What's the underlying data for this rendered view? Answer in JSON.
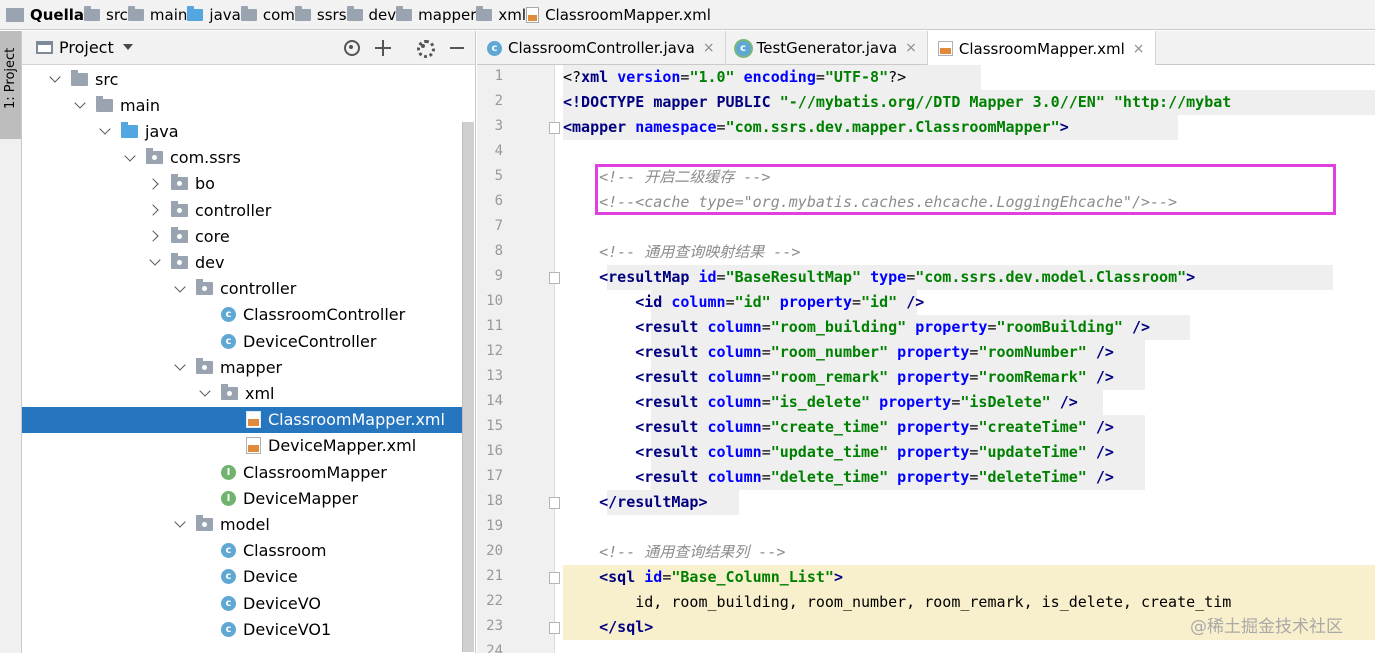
{
  "breadcrumb": [
    {
      "label": "Quella",
      "icon": "module-icon",
      "bold": true
    },
    {
      "label": "src",
      "icon": "folder-icon"
    },
    {
      "label": "main",
      "icon": "folder-icon"
    },
    {
      "label": "java",
      "icon": "folder-icon-blue"
    },
    {
      "label": "com",
      "icon": "folder-icon"
    },
    {
      "label": "ssrs",
      "icon": "folder-icon"
    },
    {
      "label": "dev",
      "icon": "folder-icon"
    },
    {
      "label": "mapper",
      "icon": "folder-icon"
    },
    {
      "label": "xml",
      "icon": "folder-icon"
    },
    {
      "label": "ClassroomMapper.xml",
      "icon": "xml-file-icon"
    }
  ],
  "tool_strip": {
    "project_label": "1: Project"
  },
  "project_panel": {
    "title": "Project"
  },
  "tree": [
    {
      "label": "src",
      "kind": "folder",
      "arrow": "down"
    },
    {
      "label": "main",
      "kind": "folder",
      "arrow": "down"
    },
    {
      "label": "java",
      "kind": "folder-blue",
      "arrow": "down"
    },
    {
      "label": "com.ssrs",
      "kind": "package",
      "arrow": "down"
    },
    {
      "label": "bo",
      "kind": "package",
      "arrow": "right"
    },
    {
      "label": "controller",
      "kind": "package",
      "arrow": "right"
    },
    {
      "label": "core",
      "kind": "package",
      "arrow": "right"
    },
    {
      "label": "dev",
      "kind": "package",
      "arrow": "down"
    },
    {
      "label": "controller",
      "kind": "package",
      "arrow": "down"
    },
    {
      "label": "ClassroomController",
      "kind": "class",
      "arrow": "none"
    },
    {
      "label": "DeviceController",
      "kind": "class",
      "arrow": "none"
    },
    {
      "label": "mapper",
      "kind": "package",
      "arrow": "down"
    },
    {
      "label": "xml",
      "kind": "package",
      "arrow": "down"
    },
    {
      "label": "ClassroomMapper.xml",
      "kind": "xml",
      "arrow": "none",
      "selected": true
    },
    {
      "label": "DeviceMapper.xml",
      "kind": "xml",
      "arrow": "none"
    },
    {
      "label": "ClassroomMapper",
      "kind": "interface",
      "arrow": "none"
    },
    {
      "label": "DeviceMapper",
      "kind": "interface",
      "arrow": "none"
    },
    {
      "label": "model",
      "kind": "package",
      "arrow": "down"
    },
    {
      "label": "Classroom",
      "kind": "class",
      "arrow": "none"
    },
    {
      "label": "Device",
      "kind": "class",
      "arrow": "none"
    },
    {
      "label": "DeviceVO",
      "kind": "class",
      "arrow": "none"
    },
    {
      "label": "DeviceVO1",
      "kind": "class",
      "arrow": "none"
    }
  ],
  "tabs": [
    {
      "label": "ClassroomController.java",
      "icon": "class-icon",
      "close": "×"
    },
    {
      "label": "TestGenerator.java",
      "icon": "test-class-icon",
      "close": "×"
    },
    {
      "label": "ClassroomMapper.xml",
      "icon": "xml-file-icon",
      "close": "×",
      "active": true
    }
  ],
  "code_lines": [
    [
      [
        "pi",
        "<?"
      ],
      [
        "tg",
        "xml "
      ],
      [
        "at",
        "version"
      ],
      [
        "pl",
        "="
      ],
      [
        "vl",
        "\"1.0\""
      ],
      [
        "pl",
        " "
      ],
      [
        "at",
        "encoding"
      ],
      [
        "pl",
        "="
      ],
      [
        "vl",
        "\"UTF-8\""
      ],
      [
        "pi",
        "?>"
      ]
    ],
    [
      [
        "tg",
        "<!DOCTYPE "
      ],
      [
        "tg",
        "mapper "
      ],
      [
        "tg",
        "PUBLIC "
      ],
      [
        "vl",
        "\"-//mybatis.org//DTD Mapper 3.0//EN\""
      ],
      [
        "pl",
        " "
      ],
      [
        "vl",
        "\"http://mybat"
      ]
    ],
    [
      [
        "tg",
        "<mapper "
      ],
      [
        "at",
        "namespace"
      ],
      [
        "pl",
        "="
      ],
      [
        "vl",
        "\"com.ssrs.dev.mapper.ClassroomMapper\""
      ],
      [
        "tg",
        ">"
      ]
    ],
    [],
    [
      [
        "cm",
        "    <!-- 开启二级缓存 -->"
      ]
    ],
    [
      [
        "cm",
        "    <!--<cache type=\"org.mybatis.caches.ehcache.LoggingEhcache\"/>-->"
      ]
    ],
    [],
    [
      [
        "cm",
        "    <!-- 通用查询映射结果 -->"
      ]
    ],
    [
      [
        "pl",
        "    "
      ],
      [
        "tg",
        "<resultMap "
      ],
      [
        "at",
        "id"
      ],
      [
        "pl",
        "="
      ],
      [
        "vl",
        "\"BaseResultMap\""
      ],
      [
        "pl",
        " "
      ],
      [
        "at",
        "type"
      ],
      [
        "pl",
        "="
      ],
      [
        "vl",
        "\"com.ssrs.dev.model.Classroom\""
      ],
      [
        "tg",
        ">"
      ]
    ],
    [
      [
        "pl",
        "        "
      ],
      [
        "tg",
        "<id "
      ],
      [
        "at",
        "column"
      ],
      [
        "pl",
        "="
      ],
      [
        "vl",
        "\"id\""
      ],
      [
        "pl",
        " "
      ],
      [
        "at",
        "property"
      ],
      [
        "pl",
        "="
      ],
      [
        "vl",
        "\"id\""
      ],
      [
        "pl",
        " "
      ],
      [
        "tg",
        "/>"
      ]
    ],
    [
      [
        "pl",
        "        "
      ],
      [
        "tg",
        "<result "
      ],
      [
        "at",
        "column"
      ],
      [
        "pl",
        "="
      ],
      [
        "vl",
        "\"room_building\""
      ],
      [
        "pl",
        " "
      ],
      [
        "at",
        "property"
      ],
      [
        "pl",
        "="
      ],
      [
        "vl",
        "\"roomBuilding\""
      ],
      [
        "pl",
        " "
      ],
      [
        "tg",
        "/>"
      ]
    ],
    [
      [
        "pl",
        "        "
      ],
      [
        "tg",
        "<result "
      ],
      [
        "at",
        "column"
      ],
      [
        "pl",
        "="
      ],
      [
        "vl",
        "\"room_number\""
      ],
      [
        "pl",
        " "
      ],
      [
        "at",
        "property"
      ],
      [
        "pl",
        "="
      ],
      [
        "vl",
        "\"roomNumber\""
      ],
      [
        "pl",
        " "
      ],
      [
        "tg",
        "/>"
      ]
    ],
    [
      [
        "pl",
        "        "
      ],
      [
        "tg",
        "<result "
      ],
      [
        "at",
        "column"
      ],
      [
        "pl",
        "="
      ],
      [
        "vl",
        "\"room_remark\""
      ],
      [
        "pl",
        " "
      ],
      [
        "at",
        "property"
      ],
      [
        "pl",
        "="
      ],
      [
        "vl",
        "\"roomRemark\""
      ],
      [
        "pl",
        " "
      ],
      [
        "tg",
        "/>"
      ]
    ],
    [
      [
        "pl",
        "        "
      ],
      [
        "tg",
        "<result "
      ],
      [
        "at",
        "column"
      ],
      [
        "pl",
        "="
      ],
      [
        "vl",
        "\"is_delete\""
      ],
      [
        "pl",
        " "
      ],
      [
        "at",
        "property"
      ],
      [
        "pl",
        "="
      ],
      [
        "vl",
        "\"isDelete\""
      ],
      [
        "pl",
        " "
      ],
      [
        "tg",
        "/>"
      ]
    ],
    [
      [
        "pl",
        "        "
      ],
      [
        "tg",
        "<result "
      ],
      [
        "at",
        "column"
      ],
      [
        "pl",
        "="
      ],
      [
        "vl",
        "\"create_time\""
      ],
      [
        "pl",
        " "
      ],
      [
        "at",
        "property"
      ],
      [
        "pl",
        "="
      ],
      [
        "vl",
        "\"createTime\""
      ],
      [
        "pl",
        " "
      ],
      [
        "tg",
        "/>"
      ]
    ],
    [
      [
        "pl",
        "        "
      ],
      [
        "tg",
        "<result "
      ],
      [
        "at",
        "column"
      ],
      [
        "pl",
        "="
      ],
      [
        "vl",
        "\"update_time\""
      ],
      [
        "pl",
        " "
      ],
      [
        "at",
        "property"
      ],
      [
        "pl",
        "="
      ],
      [
        "vl",
        "\"updateTime\""
      ],
      [
        "pl",
        " "
      ],
      [
        "tg",
        "/>"
      ]
    ],
    [
      [
        "pl",
        "        "
      ],
      [
        "tg",
        "<result "
      ],
      [
        "at",
        "column"
      ],
      [
        "pl",
        "="
      ],
      [
        "vl",
        "\"delete_time\""
      ],
      [
        "pl",
        " "
      ],
      [
        "at",
        "property"
      ],
      [
        "pl",
        "="
      ],
      [
        "vl",
        "\"deleteTime\""
      ],
      [
        "pl",
        " "
      ],
      [
        "tg",
        "/>"
      ]
    ],
    [
      [
        "pl",
        "    "
      ],
      [
        "tg",
        "</resultMap>"
      ]
    ],
    [],
    [
      [
        "cm",
        "    <!-- 通用查询结果列 -->"
      ]
    ],
    [
      [
        "pl",
        "    "
      ],
      [
        "tg",
        "<sql "
      ],
      [
        "at",
        "id"
      ],
      [
        "pl",
        "="
      ],
      [
        "vl",
        "\"Base_Column_List\""
      ],
      [
        "tg",
        ">"
      ]
    ],
    [
      [
        "pl",
        "        id, room_building, room_number, room_remark, is_delete, create_tim"
      ]
    ],
    [
      [
        "pl",
        "    "
      ],
      [
        "tg",
        "</sql>"
      ]
    ],
    []
  ],
  "watermark": "@稀土掘金技术社区"
}
